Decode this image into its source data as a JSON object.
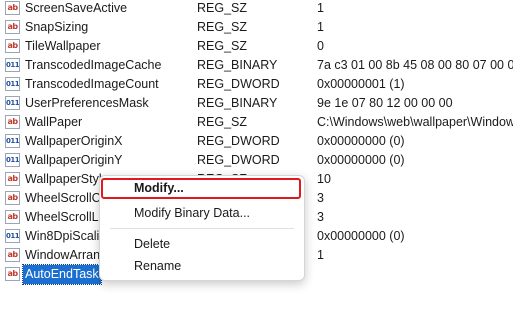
{
  "registry": {
    "rows": [
      {
        "name": "ScreenSaveActive",
        "type": "REG_SZ",
        "data": "1",
        "icon": "ab"
      },
      {
        "name": "SnapSizing",
        "type": "REG_SZ",
        "data": "1",
        "icon": "ab"
      },
      {
        "name": "TileWallpaper",
        "type": "REG_SZ",
        "data": "0",
        "icon": "ab"
      },
      {
        "name": "TranscodedImageCache",
        "type": "REG_BINARY",
        "data": "7a c3 01 00 8b 45 08 00 80 07 00 00 b0",
        "icon": "bin"
      },
      {
        "name": "TranscodedImageCount",
        "type": "REG_DWORD",
        "data": "0x00000001 (1)",
        "icon": "bin"
      },
      {
        "name": "UserPreferencesMask",
        "type": "REG_BINARY",
        "data": "9e 1e 07 80 12 00 00 00",
        "icon": "bin"
      },
      {
        "name": "WallPaper",
        "type": "REG_SZ",
        "data": "C:\\Windows\\web\\wallpaper\\Window",
        "icon": "ab"
      },
      {
        "name": "WallpaperOriginX",
        "type": "REG_DWORD",
        "data": "0x00000000 (0)",
        "icon": "bin"
      },
      {
        "name": "WallpaperOriginY",
        "type": "REG_DWORD",
        "data": "0x00000000 (0)",
        "icon": "bin"
      },
      {
        "name": "WallpaperStyle",
        "type": "REG_SZ",
        "data": "10",
        "icon": "ab"
      },
      {
        "name": "WheelScrollChars",
        "type": "",
        "data": "3",
        "icon": "ab"
      },
      {
        "name": "WheelScrollLines",
        "type": "",
        "data": "3",
        "icon": "ab"
      },
      {
        "name": "Win8DpiScaling",
        "type": "",
        "data": "0x00000000 (0)",
        "icon": "bin"
      },
      {
        "name": "WindowArrangementActive",
        "type": "",
        "data": "1",
        "icon": "ab"
      },
      {
        "name": "AutoEndTask",
        "type": "",
        "data": "",
        "icon": "ab",
        "selected": true
      }
    ]
  },
  "context_menu": {
    "modify": "Modify...",
    "modify_binary": "Modify Binary Data...",
    "delete": "Delete",
    "rename": "Rename"
  },
  "icons": {
    "string_value": "string-value-icon",
    "binary_value": "binary-value-icon"
  },
  "colors": {
    "selection": "#1a6fd1",
    "highlight_border": "#e0191f"
  }
}
